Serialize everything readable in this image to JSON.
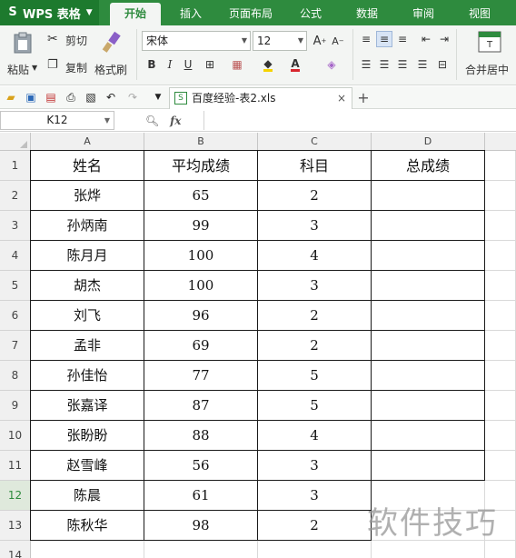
{
  "app": {
    "name": "WPS 表格"
  },
  "tabs": [
    "开始",
    "插入",
    "页面布局",
    "公式",
    "数据",
    "审阅",
    "视图"
  ],
  "active_tab": "开始",
  "ribbon": {
    "paste": "粘贴",
    "cut": "剪切",
    "copy": "复制",
    "format_painter": "格式刷",
    "font_name": "宋体",
    "font_size": "12",
    "merge_center": "合并居中"
  },
  "document": {
    "tab_title": "百度经验-表2.xls"
  },
  "formula_bar": {
    "cell_ref": "K12",
    "fx_label": "fx",
    "value": ""
  },
  "columns": [
    "A",
    "B",
    "C",
    "D"
  ],
  "rows": [
    "1",
    "2",
    "3",
    "4",
    "5",
    "6",
    "7",
    "8",
    "9",
    "10",
    "11",
    "12",
    "13",
    "14"
  ],
  "selected_row": "12",
  "table": {
    "headers": [
      "姓名",
      "平均成绩",
      "科目",
      "总成绩"
    ],
    "rows": [
      [
        "张烨",
        "65",
        "2",
        ""
      ],
      [
        "孙炳南",
        "99",
        "3",
        ""
      ],
      [
        "陈月月",
        "100",
        "4",
        ""
      ],
      [
        "胡杰",
        "100",
        "3",
        ""
      ],
      [
        "刘飞",
        "96",
        "2",
        ""
      ],
      [
        "孟非",
        "69",
        "2",
        ""
      ],
      [
        "孙佳怡",
        "77",
        "5",
        ""
      ],
      [
        "张嘉译",
        "87",
        "5",
        ""
      ],
      [
        "张盼盼",
        "88",
        "4",
        ""
      ],
      [
        "赵雪峰",
        "56",
        "3",
        ""
      ],
      [
        "陈晨",
        "61",
        "3",
        ""
      ],
      [
        "陈秋华",
        "98",
        "2",
        ""
      ]
    ]
  },
  "watermark": "软件技巧",
  "colors": {
    "accent": "#2e8b3e",
    "accent_dark": "#1d7a2e"
  }
}
